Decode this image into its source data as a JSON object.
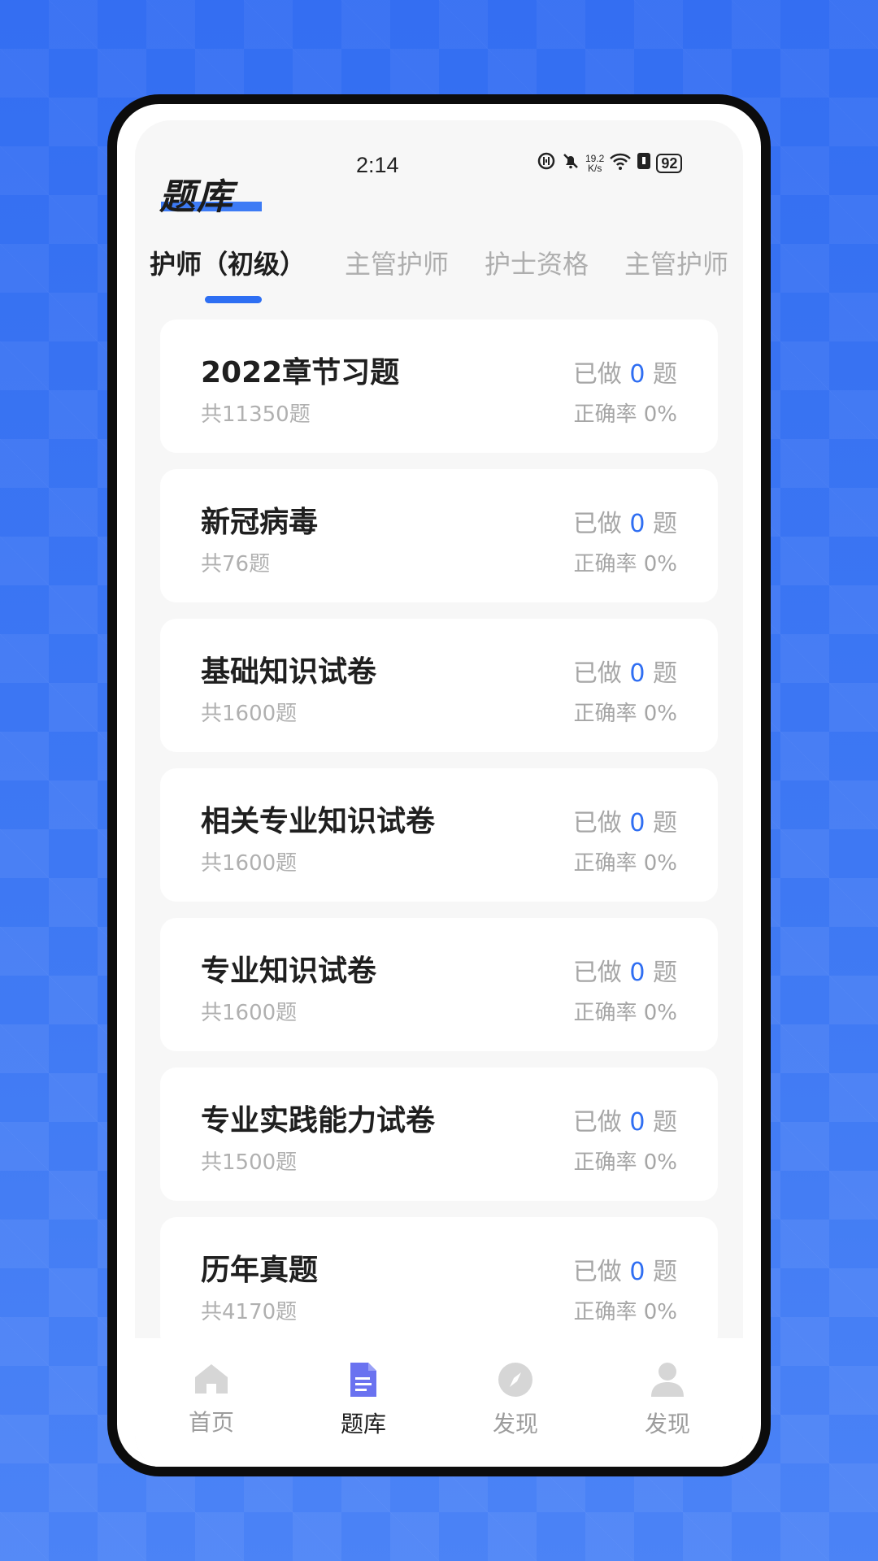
{
  "status_bar": {
    "time": "2:14",
    "speed_top": "19.2",
    "speed_bottom": "K/s",
    "battery": "92"
  },
  "header": {
    "title": "题库"
  },
  "tabs": [
    {
      "label": "护师（初级）",
      "active": true
    },
    {
      "label": "主管护师",
      "active": false
    },
    {
      "label": "护士资格",
      "active": false
    },
    {
      "label": "主管护师",
      "active": false
    }
  ],
  "cards": [
    {
      "title": "2022章节习题",
      "count": "共11350题",
      "done_prefix": "已做",
      "done_num": "0",
      "done_suffix": "题",
      "rate": "正确率 0%"
    },
    {
      "title": "新冠病毒",
      "count": "共76题",
      "done_prefix": "已做",
      "done_num": "0",
      "done_suffix": "题",
      "rate": "正确率 0%"
    },
    {
      "title": "基础知识试卷",
      "count": "共1600题",
      "done_prefix": "已做",
      "done_num": "0",
      "done_suffix": "题",
      "rate": "正确率 0%"
    },
    {
      "title": "相关专业知识试卷",
      "count": "共1600题",
      "done_prefix": "已做",
      "done_num": "0",
      "done_suffix": "题",
      "rate": "正确率 0%"
    },
    {
      "title": "专业知识试卷",
      "count": "共1600题",
      "done_prefix": "已做",
      "done_num": "0",
      "done_suffix": "题",
      "rate": "正确率 0%"
    },
    {
      "title": "专业实践能力试卷",
      "count": "共1500题",
      "done_prefix": "已做",
      "done_num": "0",
      "done_suffix": "题",
      "rate": "正确率 0%"
    },
    {
      "title": "历年真题",
      "count": "共4170题",
      "done_prefix": "已做",
      "done_num": "0",
      "done_suffix": "题",
      "rate": "正确率 0%"
    }
  ],
  "bottom_nav": [
    {
      "label": "首页",
      "icon": "home-icon",
      "active": false
    },
    {
      "label": "题库",
      "icon": "document-icon",
      "active": true
    },
    {
      "label": "发现",
      "icon": "compass-icon",
      "active": false
    },
    {
      "label": "发现",
      "icon": "person-icon",
      "active": false
    }
  ],
  "colors": {
    "accent": "#2f6ef2",
    "background": "#3f79f3",
    "card": "#ffffff",
    "nav_icon": "#d6d6d6",
    "nav_icon_active": "#6a72f0"
  }
}
